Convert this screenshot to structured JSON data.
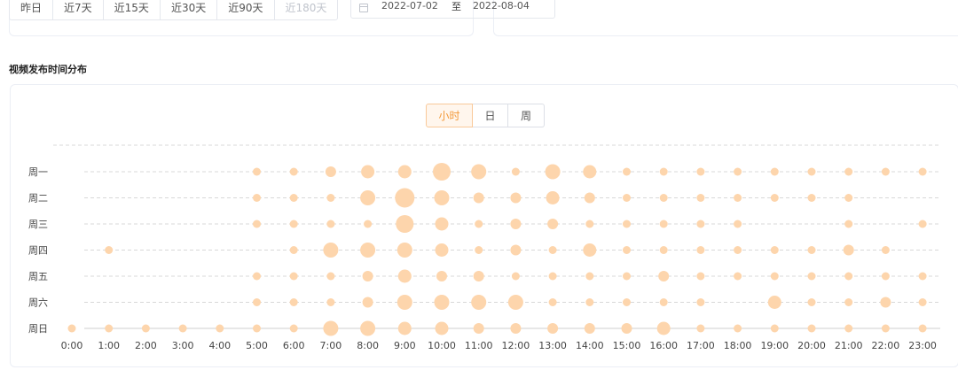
{
  "date_range": {
    "options": [
      "昨日",
      "近7天",
      "近15天",
      "近30天",
      "近90天",
      "近180天"
    ],
    "disabled_option": "近180天",
    "start": "2022-07-02",
    "separator": "至",
    "end": "2022-08-04"
  },
  "section": {
    "title": "视频发布时间分布"
  },
  "toggle": {
    "hour": "小时",
    "day": "日",
    "week": "周",
    "active": "小时"
  },
  "colors": {
    "bubble": "#fdd5ac",
    "active": "#f39a3a",
    "grid": "#d8d8d8"
  },
  "chart_data": {
    "type": "scatter",
    "title": "",
    "x": [
      "0:00",
      "1:00",
      "2:00",
      "3:00",
      "4:00",
      "5:00",
      "6:00",
      "7:00",
      "8:00",
      "9:00",
      "10:00",
      "11:00",
      "12:00",
      "13:00",
      "14:00",
      "15:00",
      "16:00",
      "17:00",
      "18:00",
      "19:00",
      "20:00",
      "21:00",
      "22:00",
      "23:00"
    ],
    "y": [
      "周一",
      "周二",
      "周三",
      "周四",
      "周五",
      "周六",
      "周日"
    ],
    "grid": true,
    "size_values": [
      [
        0,
        0,
        0,
        0,
        0,
        1,
        1,
        2,
        3,
        3,
        5,
        4,
        1,
        4,
        3,
        1,
        1,
        1,
        1,
        1,
        1,
        1,
        1,
        1
      ],
      [
        0,
        0,
        0,
        0,
        0,
        1,
        1,
        1,
        4,
        6,
        4,
        2,
        2,
        3,
        2,
        1,
        1,
        1,
        1,
        1,
        1,
        1,
        0,
        0
      ],
      [
        0,
        0,
        0,
        0,
        0,
        1,
        1,
        1,
        1,
        5,
        3,
        1,
        2,
        2,
        1,
        1,
        1,
        1,
        1,
        0,
        0,
        1,
        0,
        1
      ],
      [
        0,
        1,
        0,
        0,
        0,
        0,
        1,
        4,
        4,
        4,
        3,
        1,
        2,
        1,
        3,
        1,
        1,
        1,
        1,
        1,
        1,
        2,
        1,
        0
      ],
      [
        0,
        0,
        0,
        0,
        0,
        1,
        1,
        1,
        2,
        3,
        2,
        2,
        1,
        1,
        1,
        1,
        2,
        1,
        1,
        1,
        1,
        1,
        1,
        1
      ],
      [
        0,
        0,
        0,
        0,
        0,
        1,
        1,
        1,
        2,
        4,
        4,
        4,
        4,
        1,
        1,
        1,
        1,
        1,
        0,
        3,
        1,
        1,
        2,
        1
      ],
      [
        1,
        1,
        1,
        1,
        1,
        1,
        1,
        4,
        4,
        3,
        3,
        2,
        2,
        2,
        2,
        2,
        3,
        1,
        1,
        1,
        1,
        1,
        1,
        1
      ]
    ]
  }
}
